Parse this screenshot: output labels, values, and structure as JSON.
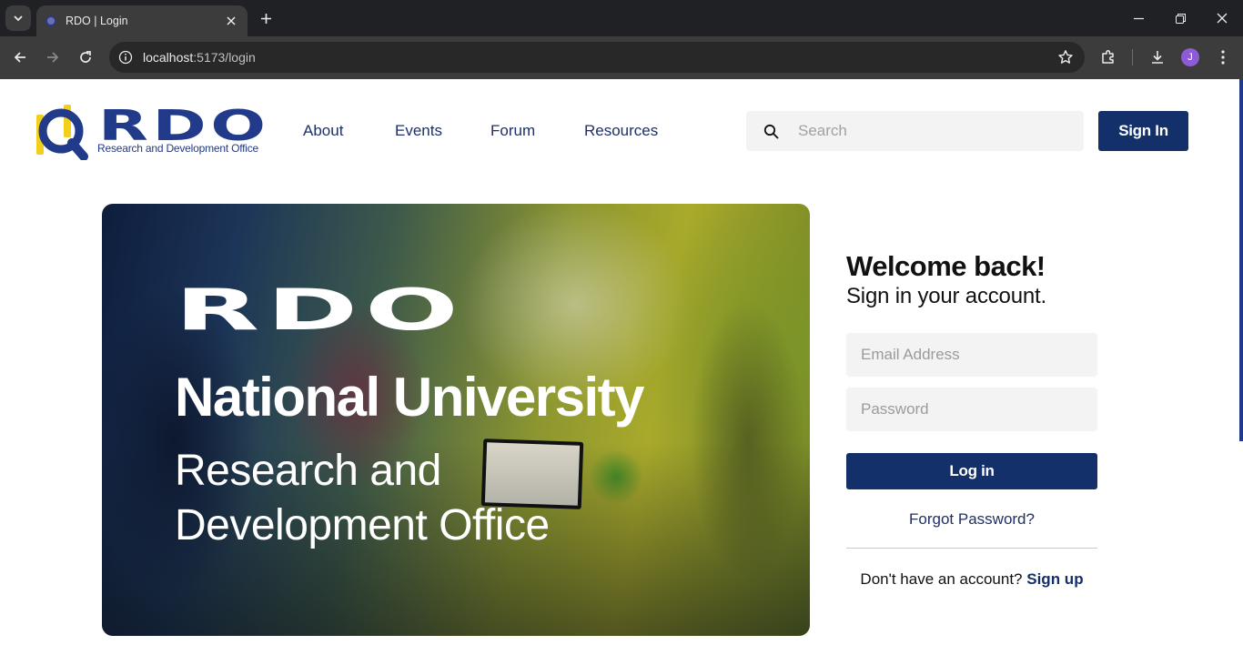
{
  "browser": {
    "tab_title": "RDO | Login",
    "url_host": "localhost",
    "url_rest": ":5173/login",
    "profile_initial": "J"
  },
  "header": {
    "logo_text": "RDO",
    "logo_subtitle": "Research and Development Office",
    "nav": [
      "About",
      "Events",
      "Forum",
      "Resources"
    ],
    "search_placeholder": "Search",
    "signin_label": "Sign In"
  },
  "hero": {
    "logo_text": "RDO",
    "title": "National University",
    "subtitle_line1": "Research and",
    "subtitle_line2": "Development Office"
  },
  "login": {
    "heading": "Welcome back!",
    "subheading": "Sign in your account.",
    "email_placeholder": "Email Address",
    "password_placeholder": "Password",
    "login_label": "Log in",
    "forgot_label": "Forgot Password?",
    "no_account_text": "Don't have an account?",
    "signup_label": "Sign up"
  },
  "colors": {
    "brand_navy": "#14306a",
    "logo_blue": "#223a8a",
    "logo_yellow": "#f2cf1d"
  }
}
